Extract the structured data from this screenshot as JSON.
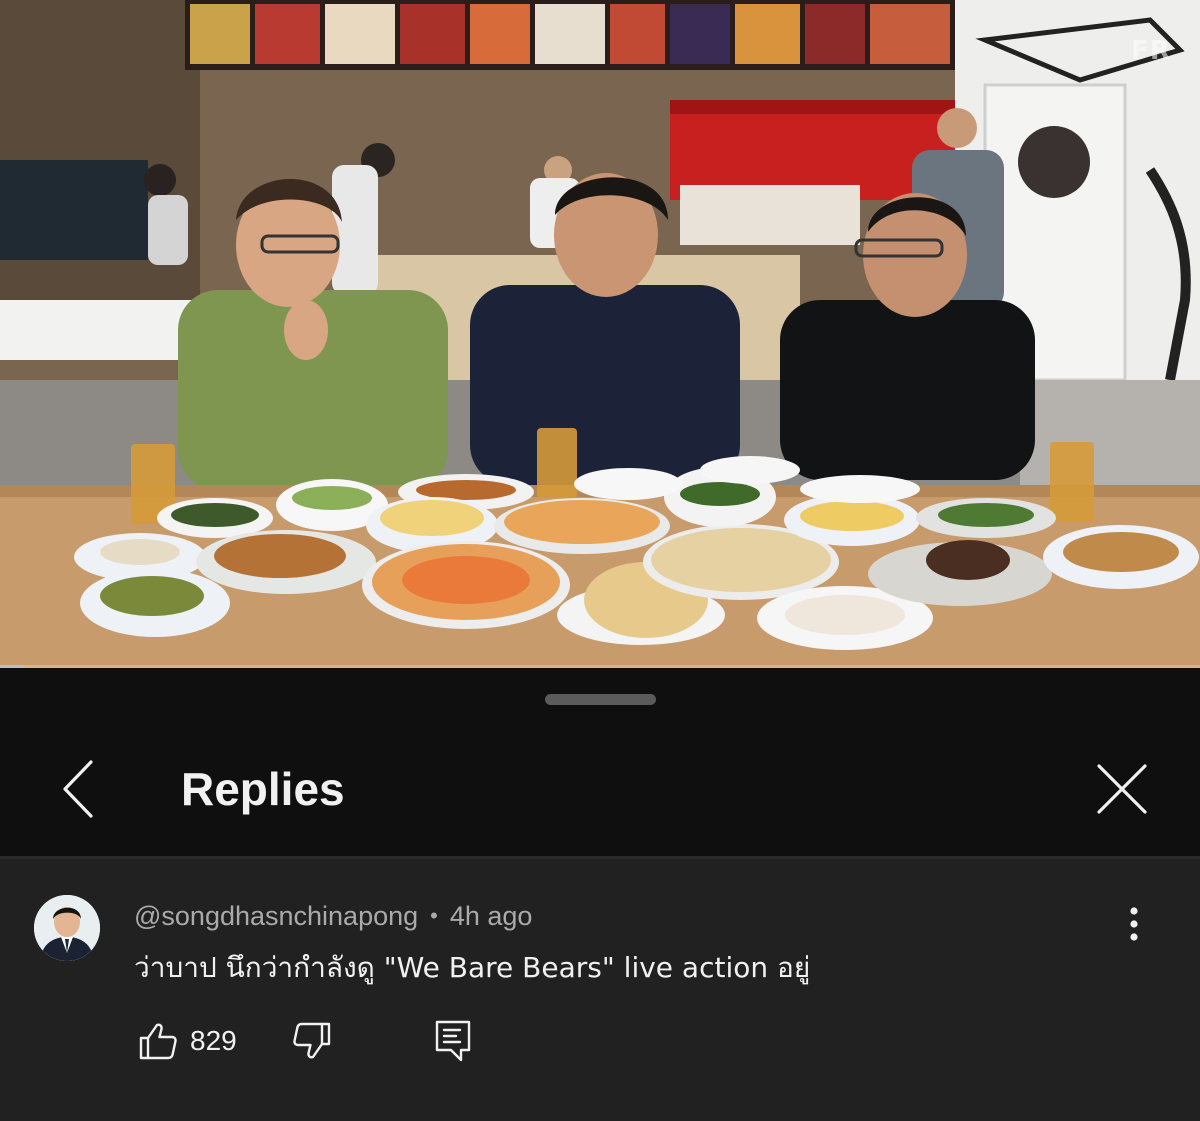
{
  "video": {
    "watermark": "FR",
    "progress_fraction": 0.02
  },
  "replies_panel": {
    "title": "Replies",
    "back_icon": "chevron-left-icon",
    "close_icon": "close-icon"
  },
  "comment": {
    "author": "@songdhasnchinapong",
    "separator": "•",
    "time": "4h ago",
    "text": "ว่าบาป นึกว่ากำลังดู \"We Bare Bears\" live action อยู่",
    "like_count": "829",
    "icons": {
      "like": "thumbs-up-icon",
      "dislike": "thumbs-down-icon",
      "reply": "reply-icon",
      "more": "more-vertical-icon"
    }
  },
  "colors": {
    "sheet_background": "#0f0f0f",
    "comment_background": "#212121",
    "text_primary": "#f1f1f1",
    "text_secondary": "#aaaaaa"
  }
}
